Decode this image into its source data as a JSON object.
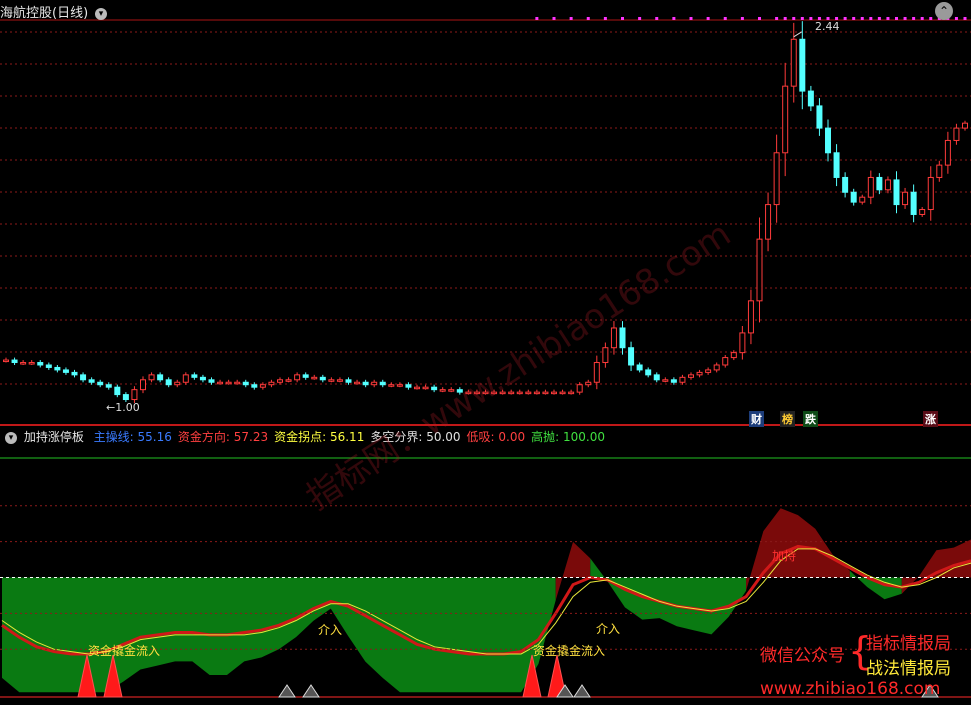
{
  "upper_panel": {
    "title": "海航控股(日线)",
    "high_label": "2.44",
    "low_label": "1.00",
    "badges": [
      "财",
      "榜",
      "跌",
      "涨"
    ],
    "colors": {
      "up": "#ff3b3b",
      "down": "#54ffff",
      "grid": "#8b1a1a",
      "dots": "#ff33ff"
    }
  },
  "lower_panel": {
    "title": "加持涨停板",
    "indicators": [
      {
        "label": "主操线:",
        "value": "55.16",
        "color": "#3a7bff"
      },
      {
        "label": "资金方向:",
        "value": "57.23",
        "color": "#ff4040"
      },
      {
        "label": "资金拐点:",
        "value": "56.11",
        "color": "#ffff40"
      },
      {
        "label": "多空分界:",
        "value": "50.00",
        "color": "#e0e0e0"
      },
      {
        "label": "低吸:",
        "value": "0.00",
        "color": "#ff4040"
      },
      {
        "label": "高抛:",
        "value": "100.00",
        "color": "#40e040"
      }
    ],
    "annotations": [
      "资金撬金流入",
      "资金撬金流入",
      "介入",
      "介入",
      "加持"
    ]
  },
  "watermark": {
    "url_diag": "www.zhibiao168.com",
    "diag_prefix": "指标网："
  },
  "promo": {
    "wechat": "微信公众号",
    "name1": "指标情报局",
    "name2": "战法情报局",
    "url": "www.zhibiao168.com"
  },
  "chart_data": [
    {
      "type": "candlestick",
      "title": "海航控股(日线)",
      "period": "daily",
      "annotations": {
        "high": 2.44,
        "low": 1.0
      },
      "ylim": [
        0.96,
        2.5
      ],
      "close": [
        1.13,
        1.12,
        1.12,
        1.12,
        1.11,
        1.1,
        1.09,
        1.08,
        1.07,
        1.05,
        1.04,
        1.03,
        1.02,
        0.99,
        0.97,
        1.01,
        1.05,
        1.07,
        1.05,
        1.03,
        1.04,
        1.07,
        1.06,
        1.05,
        1.04,
        1.04,
        1.04,
        1.04,
        1.03,
        1.02,
        1.03,
        1.04,
        1.05,
        1.05,
        1.07,
        1.06,
        1.06,
        1.05,
        1.05,
        1.05,
        1.04,
        1.04,
        1.03,
        1.04,
        1.03,
        1.03,
        1.03,
        1.02,
        1.02,
        1.02,
        1.01,
        1.01,
        1.01,
        1.0,
        1.0,
        1.0,
        1.0,
        1.0,
        1.0,
        1.0,
        1.0,
        1.0,
        1.0,
        1.0,
        1.0,
        1.0,
        1.0,
        1.03,
        1.04,
        1.12,
        1.18,
        1.26,
        1.18,
        1.11,
        1.09,
        1.07,
        1.05,
        1.05,
        1.04,
        1.06,
        1.07,
        1.08,
        1.09,
        1.11,
        1.14,
        1.16,
        1.24,
        1.37,
        1.62,
        1.76,
        1.97,
        2.24,
        2.43,
        2.22,
        2.16,
        2.07,
        1.97,
        1.87,
        1.81,
        1.77,
        1.79,
        1.87,
        1.82,
        1.86,
        1.76,
        1.81,
        1.72,
        1.74,
        1.87,
        1.92,
        2.02,
        2.07,
        2.09
      ]
    },
    {
      "type": "line",
      "title": "加持涨停板",
      "ylim": [
        0,
        100
      ],
      "series": [
        {
          "name": "主操线",
          "last": 55.16
        },
        {
          "name": "资金方向",
          "last": 57.23,
          "values": [
            30,
            25,
            21,
            19,
            18,
            18,
            19,
            22,
            25,
            26,
            27,
            27,
            26,
            26,
            27,
            28,
            30,
            33,
            37,
            40,
            38,
            34,
            30,
            26,
            22,
            20,
            19,
            18,
            18,
            18,
            19,
            24,
            35,
            47,
            50,
            49,
            45,
            42,
            40,
            38,
            37,
            36,
            38,
            42,
            52,
            60,
            63,
            62,
            58,
            54,
            50,
            47,
            46,
            48,
            52,
            55,
            57
          ]
        },
        {
          "name": "资金拐点",
          "last": 56.11,
          "values": [
            32,
            27,
            23,
            20,
            19,
            18,
            19,
            21,
            24,
            25,
            26,
            26,
            26,
            26,
            26,
            27,
            29,
            32,
            36,
            39,
            39,
            36,
            32,
            28,
            24,
            21,
            20,
            19,
            18,
            18,
            18,
            22,
            31,
            42,
            48,
            49,
            46,
            43,
            40,
            38,
            37,
            36,
            37,
            40,
            48,
            57,
            62,
            62,
            59,
            55,
            51,
            48,
            46,
            47,
            50,
            54,
            56
          ]
        },
        {
          "name": "多空分界",
          "last": 50.0
        },
        {
          "name": "低吸",
          "last": 0.0
        },
        {
          "name": "高抛",
          "last": 100.0
        }
      ]
    }
  ]
}
